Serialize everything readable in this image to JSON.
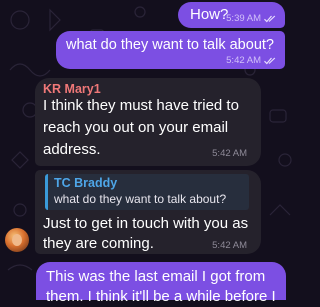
{
  "colors": {
    "background": "#130f1d",
    "outgoing_bubble": "#7c4fe3",
    "incoming_bubble": "#25222c",
    "sender_mary": "#f07878",
    "sender_braddy": "#4ea6e8"
  },
  "messages": [
    {
      "direction": "out",
      "text": "How?",
      "time": "5:39 AM",
      "status_icon": "double-check-icon"
    },
    {
      "direction": "out",
      "text": "what do they want to talk about?",
      "time": "5:42 AM",
      "status_icon": "double-check-icon"
    },
    {
      "direction": "in",
      "sender": "KR Mary1",
      "lines": [
        "I think they must have tried to",
        "reach you out on your email",
        "address."
      ],
      "time": "5:42 AM"
    },
    {
      "direction": "in",
      "quote": {
        "sender": "TC Braddy",
        "text": "what do they want to talk about?"
      },
      "lines": [
        "Just to get in touch with you as",
        "they are coming."
      ],
      "time": "5:42 AM",
      "avatar": "user-avatar"
    },
    {
      "direction": "out",
      "lines": [
        "This was the last email I got from",
        "them. I think it'll be a while before I"
      ]
    }
  ]
}
